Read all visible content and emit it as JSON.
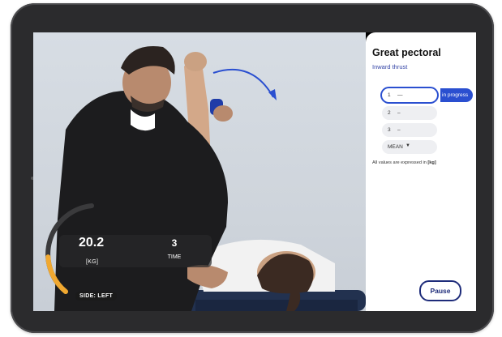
{
  "exercise": {
    "title": "Great pectoral",
    "subtitle": "Inward thrust"
  },
  "repetitions": [
    {
      "number": "1",
      "value": "—",
      "status": "in progress",
      "active": true
    },
    {
      "number": "2",
      "value": "–",
      "active": false
    },
    {
      "number": "3",
      "value": "–",
      "active": false
    }
  ],
  "aggregate": {
    "selected": "MEAN",
    "caret": "▼"
  },
  "units_note": {
    "prefix": "All values are expressed in",
    "unit": "[kg]"
  },
  "controls": {
    "pause_label": "Pause"
  },
  "gauge": {
    "value": "20.2",
    "unit": "[KG]",
    "fill_fraction": 0.35,
    "accent_color": "#f0a830"
  },
  "reps_counter": {
    "value": "3",
    "label": "TIME"
  },
  "side": {
    "label": "SIDE: LEFT"
  },
  "colors": {
    "accent": "#2a4fd0",
    "pause": "#1e2c7a",
    "arrow": "#2a4fd0"
  }
}
